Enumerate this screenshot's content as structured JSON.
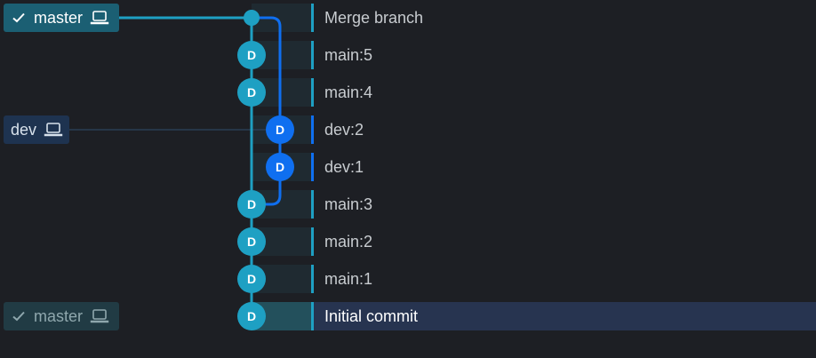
{
  "colors": {
    "background": "#1d1f24",
    "main_lane": "#1ea0c3",
    "dev_lane": "#0f6ff0",
    "tag_master_bg": "#1b5f73",
    "tag_master_inactive_bg": "#213b44",
    "tag_dev_bg": "#1e3350",
    "selected_row_bg": "#273450",
    "avatar_text": "#ffffff"
  },
  "branches": [
    {
      "name": "master",
      "checked": true,
      "icon": "laptop-icon",
      "active": true
    },
    {
      "name": "dev",
      "checked": false,
      "icon": "laptop-icon",
      "active": true
    },
    {
      "name": "master",
      "checked": true,
      "icon": "laptop-icon",
      "active": false
    }
  ],
  "commits": [
    {
      "message": "Merge branch",
      "author_initial": "",
      "lane": "main",
      "merge": true
    },
    {
      "message": "main:5",
      "author_initial": "D",
      "lane": "main"
    },
    {
      "message": "main:4",
      "author_initial": "D",
      "lane": "main"
    },
    {
      "message": "dev:2",
      "author_initial": "D",
      "lane": "dev"
    },
    {
      "message": "dev:1",
      "author_initial": "D",
      "lane": "dev"
    },
    {
      "message": "main:3",
      "author_initial": "D",
      "lane": "main"
    },
    {
      "message": "main:2",
      "author_initial": "D",
      "lane": "main"
    },
    {
      "message": "main:1",
      "author_initial": "D",
      "lane": "main"
    },
    {
      "message": "Initial commit",
      "author_initial": "D",
      "lane": "main",
      "selected": true
    }
  ]
}
